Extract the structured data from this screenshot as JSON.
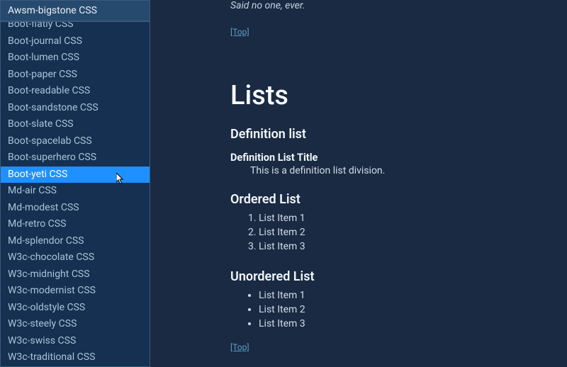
{
  "dropdown": {
    "selected": "Awsm-bigstone CSS",
    "highlighted_index": 9,
    "items": [
      "Boot-flatly CSS",
      "Boot-journal CSS",
      "Boot-lumen CSS",
      "Boot-paper CSS",
      "Boot-readable CSS",
      "Boot-sandstone CSS",
      "Boot-slate CSS",
      "Boot-spacelab CSS",
      "Boot-superhero CSS",
      "Boot-yeti CSS",
      "Md-air CSS",
      "Md-modest CSS",
      "Md-retro CSS",
      "Md-splendor CSS",
      "W3c-chocolate CSS",
      "W3c-midnight CSS",
      "W3c-modernist CSS",
      "W3c-oldstyle CSS",
      "W3c-steely CSS",
      "W3c-swiss CSS",
      "W3c-traditional CSS"
    ]
  },
  "content": {
    "quote": "Said no one, ever.",
    "top_link": "[Top]",
    "lists_heading": "Lists",
    "def_section": "Definition list",
    "def_title": "Definition List Title",
    "def_desc": "This is a definition list division.",
    "ordered_heading": "Ordered List",
    "ordered_items": [
      "List Item 1",
      "List Item 2",
      "List Item 3"
    ],
    "unordered_heading": "Unordered List",
    "unordered_items": [
      "List Item 1",
      "List Item 2",
      "List Item 3"
    ]
  }
}
